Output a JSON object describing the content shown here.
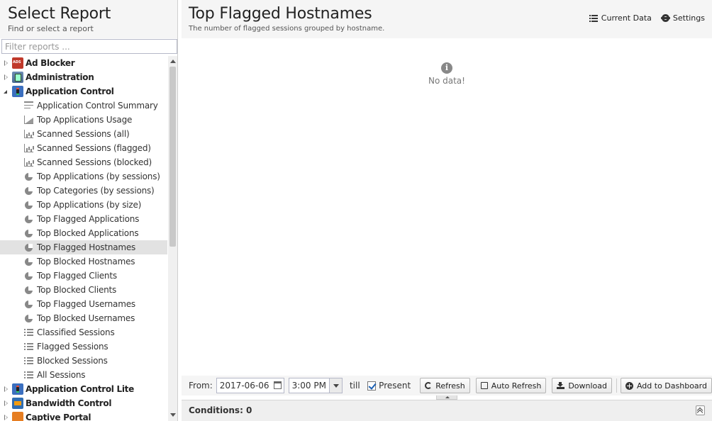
{
  "left_panel": {
    "title": "Select Report",
    "subtitle": "Find or select a report",
    "filter_placeholder": "Filter reports ..."
  },
  "tree": [
    {
      "type": "app",
      "label": "Ad Blocker",
      "icon": "ad-blocker-icon",
      "expanded": false
    },
    {
      "type": "app",
      "label": "Administration",
      "icon": "administration-icon",
      "expanded": false
    },
    {
      "type": "app",
      "label": "Application Control",
      "icon": "application-control-icon",
      "expanded": true
    },
    {
      "type": "leaf",
      "label": "Application Control Summary",
      "icon": "text-report-icon"
    },
    {
      "type": "leaf",
      "label": "Top Applications Usage",
      "icon": "area-chart-icon"
    },
    {
      "type": "leaf",
      "label": "Scanned Sessions (all)",
      "icon": "bar-chart-icon"
    },
    {
      "type": "leaf",
      "label": "Scanned Sessions (flagged)",
      "icon": "bar-chart-icon"
    },
    {
      "type": "leaf",
      "label": "Scanned Sessions (blocked)",
      "icon": "bar-chart-icon"
    },
    {
      "type": "leaf",
      "label": "Top Applications (by sessions)",
      "icon": "pie-chart-icon"
    },
    {
      "type": "leaf",
      "label": "Top Categories (by sessions)",
      "icon": "pie-chart-icon"
    },
    {
      "type": "leaf",
      "label": "Top Applications (by size)",
      "icon": "pie-chart-icon"
    },
    {
      "type": "leaf",
      "label": "Top Flagged Applications",
      "icon": "pie-chart-icon"
    },
    {
      "type": "leaf",
      "label": "Top Blocked Applications",
      "icon": "pie-chart-icon"
    },
    {
      "type": "leaf",
      "label": "Top Flagged Hostnames",
      "icon": "pie-chart-icon",
      "selected": true
    },
    {
      "type": "leaf",
      "label": "Top Blocked Hostnames",
      "icon": "pie-chart-icon"
    },
    {
      "type": "leaf",
      "label": "Top Flagged Clients",
      "icon": "pie-chart-icon"
    },
    {
      "type": "leaf",
      "label": "Top Blocked Clients",
      "icon": "pie-chart-icon"
    },
    {
      "type": "leaf",
      "label": "Top Flagged Usernames",
      "icon": "pie-chart-icon"
    },
    {
      "type": "leaf",
      "label": "Top Blocked Usernames",
      "icon": "pie-chart-icon"
    },
    {
      "type": "leaf",
      "label": "Classified Sessions",
      "icon": "list-icon"
    },
    {
      "type": "leaf",
      "label": "Flagged Sessions",
      "icon": "list-icon"
    },
    {
      "type": "leaf",
      "label": "Blocked Sessions",
      "icon": "list-icon"
    },
    {
      "type": "leaf",
      "label": "All Sessions",
      "icon": "list-icon"
    },
    {
      "type": "app",
      "label": "Application Control Lite",
      "icon": "application-control-lite-icon",
      "expanded": false
    },
    {
      "type": "app",
      "label": "Bandwidth Control",
      "icon": "bandwidth-control-icon",
      "expanded": false
    },
    {
      "type": "app",
      "label": "Captive Portal",
      "icon": "captive-portal-icon",
      "expanded": false
    }
  ],
  "report": {
    "title": "Top Flagged Hostnames",
    "description": "The number of flagged sessions grouped by hostname.",
    "current_data_label": "Current Data",
    "settings_label": "Settings",
    "no_data_icon_glyph": "i",
    "no_data_text": "No data!"
  },
  "toolbar": {
    "from_label": "From:",
    "from_date": "2017-06-06",
    "from_time": "3:00 PM",
    "till_label": "till",
    "present_label": "Present",
    "present_checked": true,
    "refresh_label": "Refresh",
    "auto_refresh_label": "Auto Refresh",
    "download_label": "Download",
    "add_dashboard_label": "Add to Dashboard"
  },
  "conditions": {
    "label": "Conditions: 0"
  },
  "colors": {
    "header_bg": "#f5f5f5",
    "selected_row": "#e2e2e2",
    "check_blue": "#1a5fb4"
  }
}
